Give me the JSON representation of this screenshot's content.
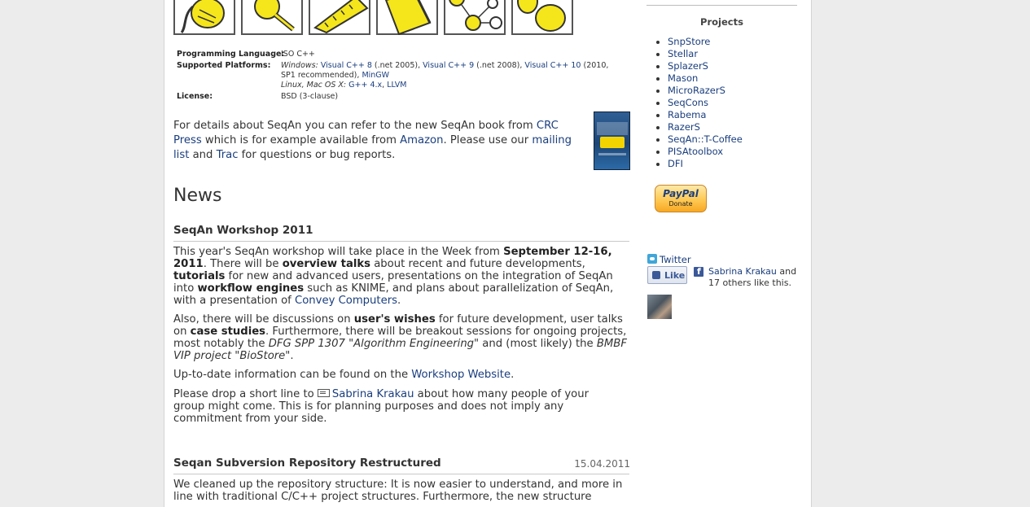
{
  "info": {
    "programming_language_label": "Programming Language:",
    "programming_language_value": "ISO C++",
    "platforms_label": "Supported Platforms:",
    "platforms_windows_prefix": "Windows:",
    "platforms_vc8": "Visual C++ 8",
    "platforms_vc8_suffix": " (.net 2005), ",
    "platforms_vc9": "Visual C++ 9",
    "platforms_vc9_suffix": " (.net 2008), ",
    "platforms_vc10": "Visual C++ 10",
    "platforms_vc10_suffix": " (2010, SP1 recommended), ",
    "platforms_mingw": "MinGW",
    "platforms_unix_prefix": "Linux, Mac OS X:",
    "platforms_gcc": "G++ 4.x",
    "platforms_sep": ", ",
    "platforms_llvm": "LLVM",
    "license_label": "License:",
    "license_value": "BSD (3-clause)"
  },
  "intro": {
    "t1": "For details about SeqAn you can refer to the new SeqAn book from ",
    "crc": "CRC Press",
    "t2": " which is for example available from ",
    "amazon": "Amazon",
    "t3": ". Please use our ",
    "mailing": "mailing list",
    "t4": " and ",
    "trac": "Trac",
    "t5": " for questions or bug reports."
  },
  "news": {
    "heading": "News",
    "workshop": {
      "title": "SeqAn Workshop 2011",
      "p1_a": "This year's SeqAn workshop will take place in the Week from ",
      "p1_b": "September 12-16, 2011",
      "p1_c": ". There will be ",
      "p1_d": "overview talks",
      "p1_e": " about recent and future developments, ",
      "p1_f": "tutorials",
      "p1_g": " for new and advanced users, presentations on the integration of SeqAn into ",
      "p1_h": "workflow engines",
      "p1_i": " such as KNIME, and plans about parallelization of SeqAn, with a presentation of ",
      "p1_j": "Convey Computers",
      "p1_k": ".",
      "p2_a": "Also, there will be discussions on ",
      "p2_b": "user's wishes",
      "p2_c": " for future development, user talks on ",
      "p2_d": "case studies",
      "p2_e": ". Furthermore, there will be breakout sessions for ongoing projects, most notably the ",
      "p2_f": "DFG SPP 1307 \"Algorithm Engineering\"",
      "p2_g": " and (most likely) the ",
      "p2_h": "BMBF VIP project \"BioStore\"",
      "p2_i": ".",
      "p3_a": "Up-to-date information can be found on the ",
      "p3_b": "Workshop Website",
      "p3_c": ".",
      "p4_a": "Please drop a short line to ",
      "p4_b": "Sabrina Krakau",
      "p4_c": " about how many people of your group might come. This is for planning purposes and does not imply any commitment from your side."
    },
    "svn": {
      "title": "Seqan Subversion Repository Restructured",
      "date": "15.04.2011",
      "p1": "We cleaned up the repository structure: It is now easier to understand, and more in line with traditional C/C++ project structures. Furthermore, the new structure"
    }
  },
  "sidebar": {
    "title": "Projects",
    "projects": [
      "SnpStore",
      "Stellar",
      "SplazerS",
      "Mason",
      "MicroRazerS",
      "SeqCons",
      "Rabema",
      "RazerS",
      "SeqAn::T-Coffee",
      "PISAtoolbox",
      "DFI"
    ],
    "paypal_brand": "PayPal",
    "paypal_label": "Donate",
    "twitter": "Twitter",
    "like_label": "Like",
    "fb_name": "Sabrina Krakau",
    "fb_text": " and 17 others like this."
  },
  "colors": {
    "link": "#1a3e7e",
    "icon_yellow": "#f5e61c",
    "background": "#ececec"
  },
  "icons": [
    "cable-icon",
    "magnifier-icon",
    "ruler-icon",
    "bucket-icon",
    "graph-icon",
    "blob-icon"
  ]
}
